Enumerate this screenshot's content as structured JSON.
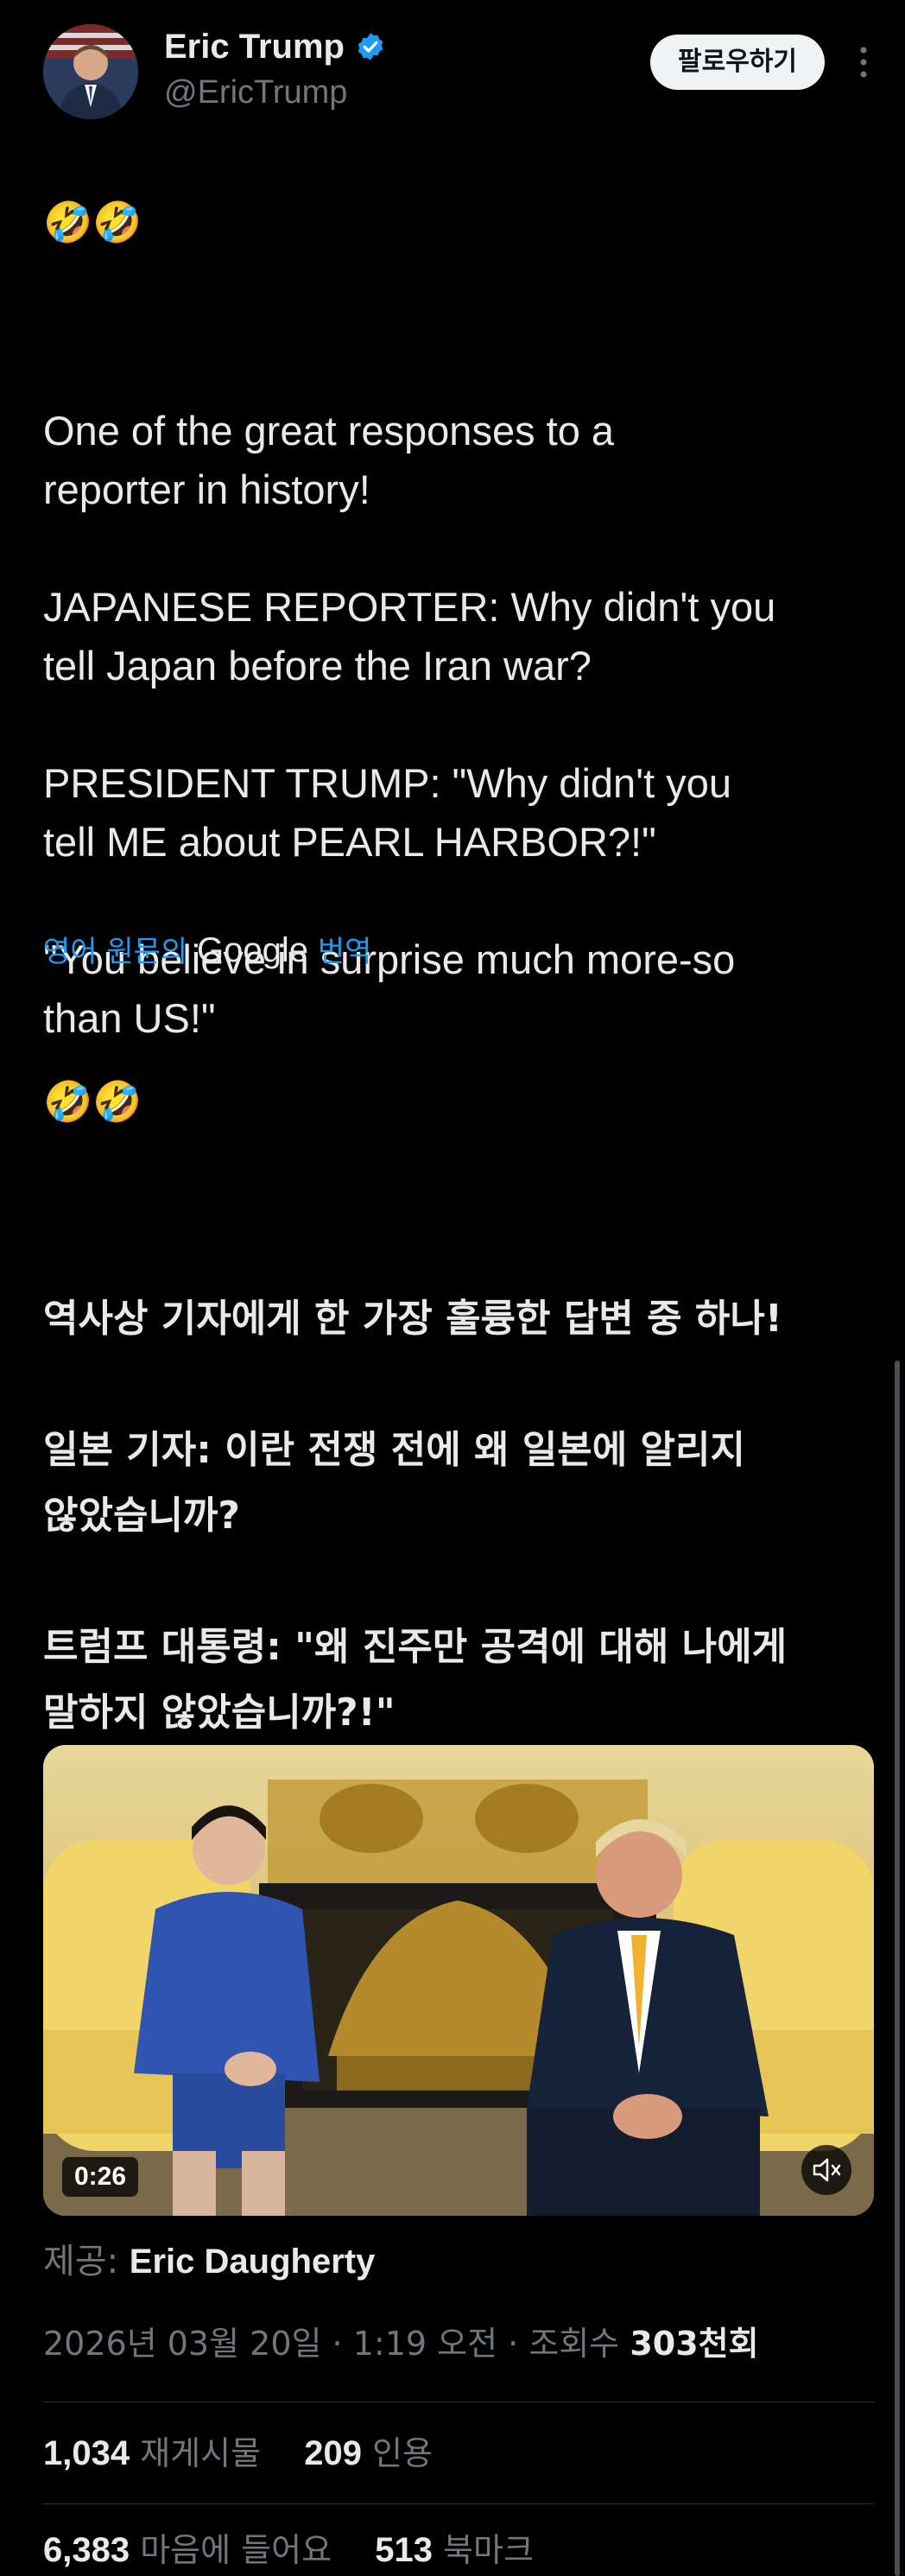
{
  "author": {
    "display_name": "Eric Trump",
    "handle": "@EricTrump",
    "verified": true
  },
  "follow_button_label": "팔로우하기",
  "tweet": {
    "emoji_top": "🤣🤣",
    "text": "One of the great responses to a\nreporter in history!\n\nJAPANESE REPORTER: Why didn't you\ntell Japan before the Iran war?\n\nPRESIDENT TRUMP: \"Why didn't you\ntell ME about PEARL HARBOR?!\"\n\n\"You believe in surprise much more-so\nthan US!\""
  },
  "translation": {
    "prefix": "영어 원문의",
    "google": "Google",
    "suffix": "번역",
    "emoji": "🤣🤣",
    "text": "역사상 기자에게 한 가장 훌륭한 답변 중 하나!\n\n일본 기자: 이란 전쟁 전에 왜 일본에 알리지\n않았습니까?\n\n트럼프 대통령: \"왜 진주만 공격에 대해 나에게\n말하지 않았습니까?!\"\n\n\"당신은 우리보다 놀라움을 훨씬 더 믿는군요!\""
  },
  "media": {
    "duration": "0:26",
    "mute_icon": "muted-speaker-icon"
  },
  "credit": {
    "label": "제공:",
    "name": "Eric Daugherty"
  },
  "meta": {
    "date": "2026년 03월 20일",
    "separator": "·",
    "time": "1:19 오전",
    "views_label": "조회수",
    "views_count": "303천회"
  },
  "stats": {
    "reposts_count": "1,034",
    "reposts_label": "재게시물",
    "quotes_count": "209",
    "quotes_label": "인용",
    "likes_count": "6,383",
    "likes_label": "마음에 들어요",
    "bookmarks_count": "513",
    "bookmarks_label": "북마크"
  },
  "colors": {
    "background": "#000000",
    "text": "#e7e9ea",
    "muted": "#71767b",
    "link": "#1d9bf0",
    "verified": "#1d9bf0"
  }
}
